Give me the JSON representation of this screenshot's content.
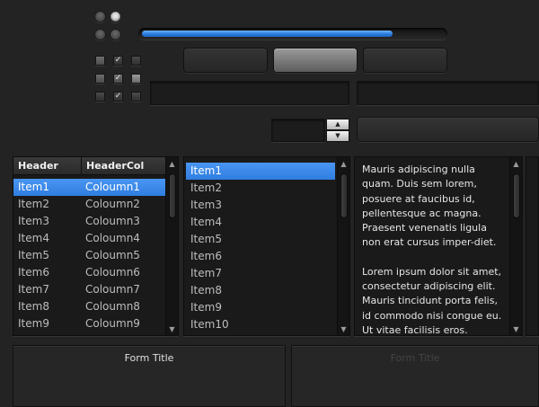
{
  "progress": {
    "fraction": 0.83
  },
  "radios": [
    {
      "checked": false
    },
    {
      "checked": true
    },
    {
      "checked": false
    },
    {
      "checked": false
    }
  ],
  "checkboxes": [
    {
      "mark": "",
      "style": "grey"
    },
    {
      "mark": "✓",
      "style": "normal"
    },
    {
      "mark": "",
      "style": "normal"
    },
    {
      "mark": "",
      "style": "grey"
    },
    {
      "mark": "✓",
      "style": "grey"
    },
    {
      "mark": "",
      "style": "light"
    },
    {
      "mark": "",
      "style": "normal"
    },
    {
      "mark": "✓",
      "style": "normal"
    },
    {
      "mark": "",
      "style": "normal"
    }
  ],
  "table": {
    "headers": [
      "Header",
      "HeaderCol"
    ],
    "rows": [
      [
        "Item1",
        "Coloumn1"
      ],
      [
        "Item2",
        "Coloumn2"
      ],
      [
        "Item3",
        "Coloumn3"
      ],
      [
        "Item4",
        "Coloumn4"
      ],
      [
        "Item5",
        "Coloumn5"
      ],
      [
        "Item6",
        "Coloumn6"
      ],
      [
        "Item7",
        "Coloumn7"
      ],
      [
        "Item8",
        "Coloumn8"
      ],
      [
        "Item9",
        "Coloumn9"
      ]
    ],
    "selected_index": 0
  },
  "list": {
    "items": [
      "Item1",
      "Item2",
      "Item3",
      "Item4",
      "Item5",
      "Item6",
      "Item7",
      "Item8",
      "Item9",
      "Item10"
    ],
    "selected_index": 0
  },
  "textarea": {
    "paragraph1": "Mauris adipiscing nulla quam. Duis sem lorem, posuere at faucibus id, pellentesque ac magna. Praesent venenatis ligula non erat cursus imper-diet.",
    "paragraph2": "Lorem ipsum dolor sit amet, consectetur adipiscing elit. Mauris tincidunt porta felis, id commodo nisi congue eu. Ut vitae facilisis eros."
  },
  "forms": [
    {
      "title": "Form Title"
    },
    {
      "title": "Form Title"
    }
  ],
  "icons": {
    "spinner_up": "▲",
    "spinner_down": "▼",
    "scroll_up": "▲",
    "scroll_down": "▼"
  },
  "colors": {
    "accent": "#2f7de0",
    "background": "#232323"
  }
}
